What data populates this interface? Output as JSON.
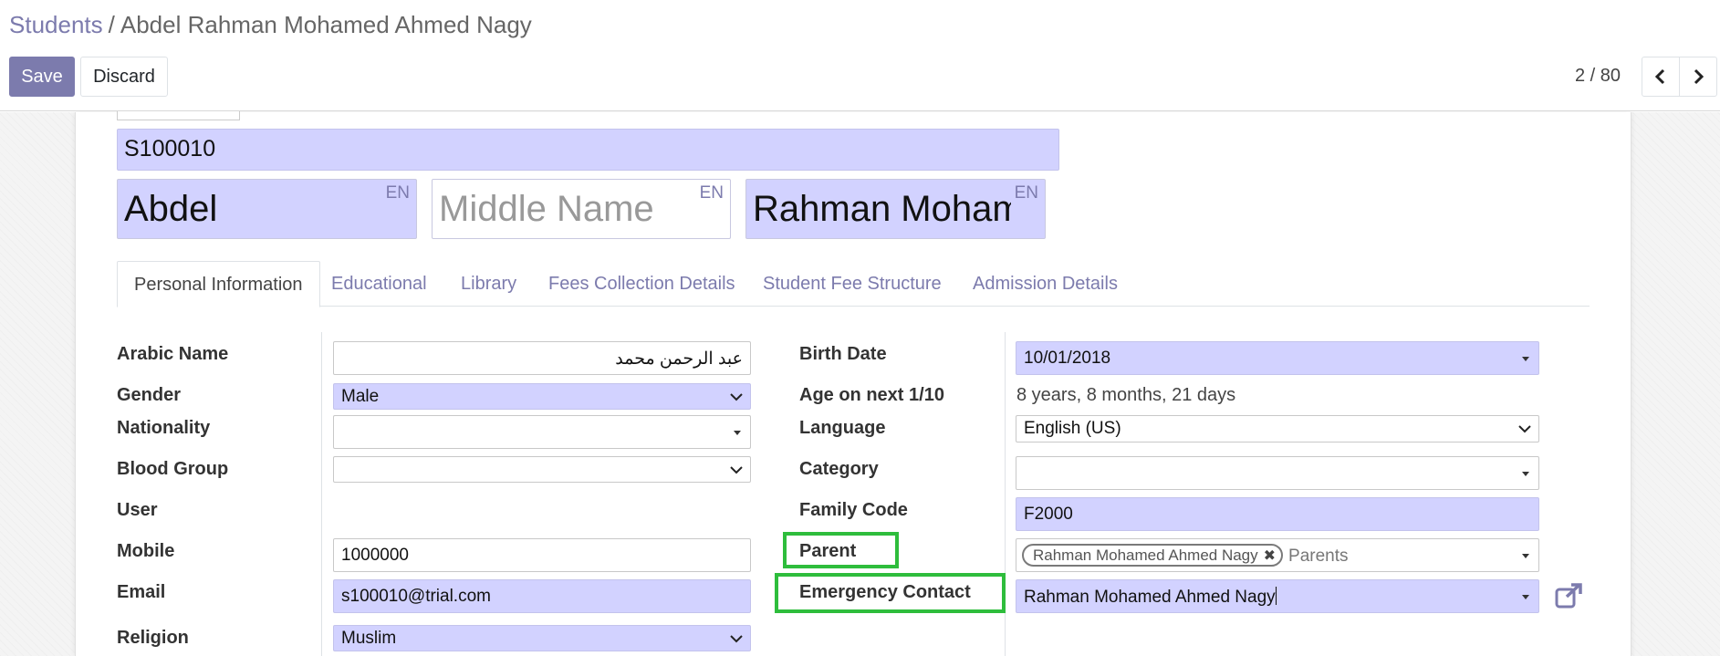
{
  "breadcrumb": {
    "parent": "Students",
    "separator": "/",
    "current": "Abdel Rahman Mohamed Ahmed Nagy"
  },
  "toolbar": {
    "save_label": "Save",
    "discard_label": "Discard"
  },
  "pager": {
    "value": "2 / 80"
  },
  "record": {
    "student_id": "S100010",
    "first_name": "Abdel",
    "middle_name_placeholder": "Middle Name",
    "last_name": "Rahman Mohamed Ahmed Nagy",
    "lang_badge": "EN"
  },
  "tabs": [
    {
      "label": "Personal Information",
      "active": true
    },
    {
      "label": "Educational"
    },
    {
      "label": "Library"
    },
    {
      "label": "Fees Collection Details"
    },
    {
      "label": "Student Fee Structure"
    },
    {
      "label": "Admission Details"
    }
  ],
  "left_fields": {
    "arabic_name": {
      "label": "Arabic Name",
      "value": "عبد الرحمن محمد"
    },
    "gender": {
      "label": "Gender",
      "value": "Male"
    },
    "nationality": {
      "label": "Nationality",
      "value": ""
    },
    "blood_group": {
      "label": "Blood Group",
      "value": ""
    },
    "user": {
      "label": "User",
      "value": ""
    },
    "mobile": {
      "label": "Mobile",
      "value": "1000000"
    },
    "email": {
      "label": "Email",
      "value": "s100010@trial.com"
    },
    "religion": {
      "label": "Religion",
      "value": "Muslim"
    }
  },
  "right_fields": {
    "birth_date": {
      "label": "Birth Date",
      "value": "10/01/2018"
    },
    "age": {
      "label": "Age on next 1/10",
      "value": "8 years, 8 months, 21 days"
    },
    "language": {
      "label": "Language",
      "value": "English (US)"
    },
    "category": {
      "label": "Category",
      "value": ""
    },
    "family_code": {
      "label": "Family Code",
      "value": "F2000"
    },
    "parent": {
      "label": "Parent",
      "tag": "Rahman Mohamed Ahmed Nagy",
      "placeholder": "Parents"
    },
    "emergency_contact": {
      "label": "Emergency Contact",
      "value": "Rahman Mohamed Ahmed Nagy"
    }
  },
  "colors": {
    "accent": "#7c7bad",
    "required_bg": "#d2d2ff",
    "highlight": "#2ebd3c"
  }
}
